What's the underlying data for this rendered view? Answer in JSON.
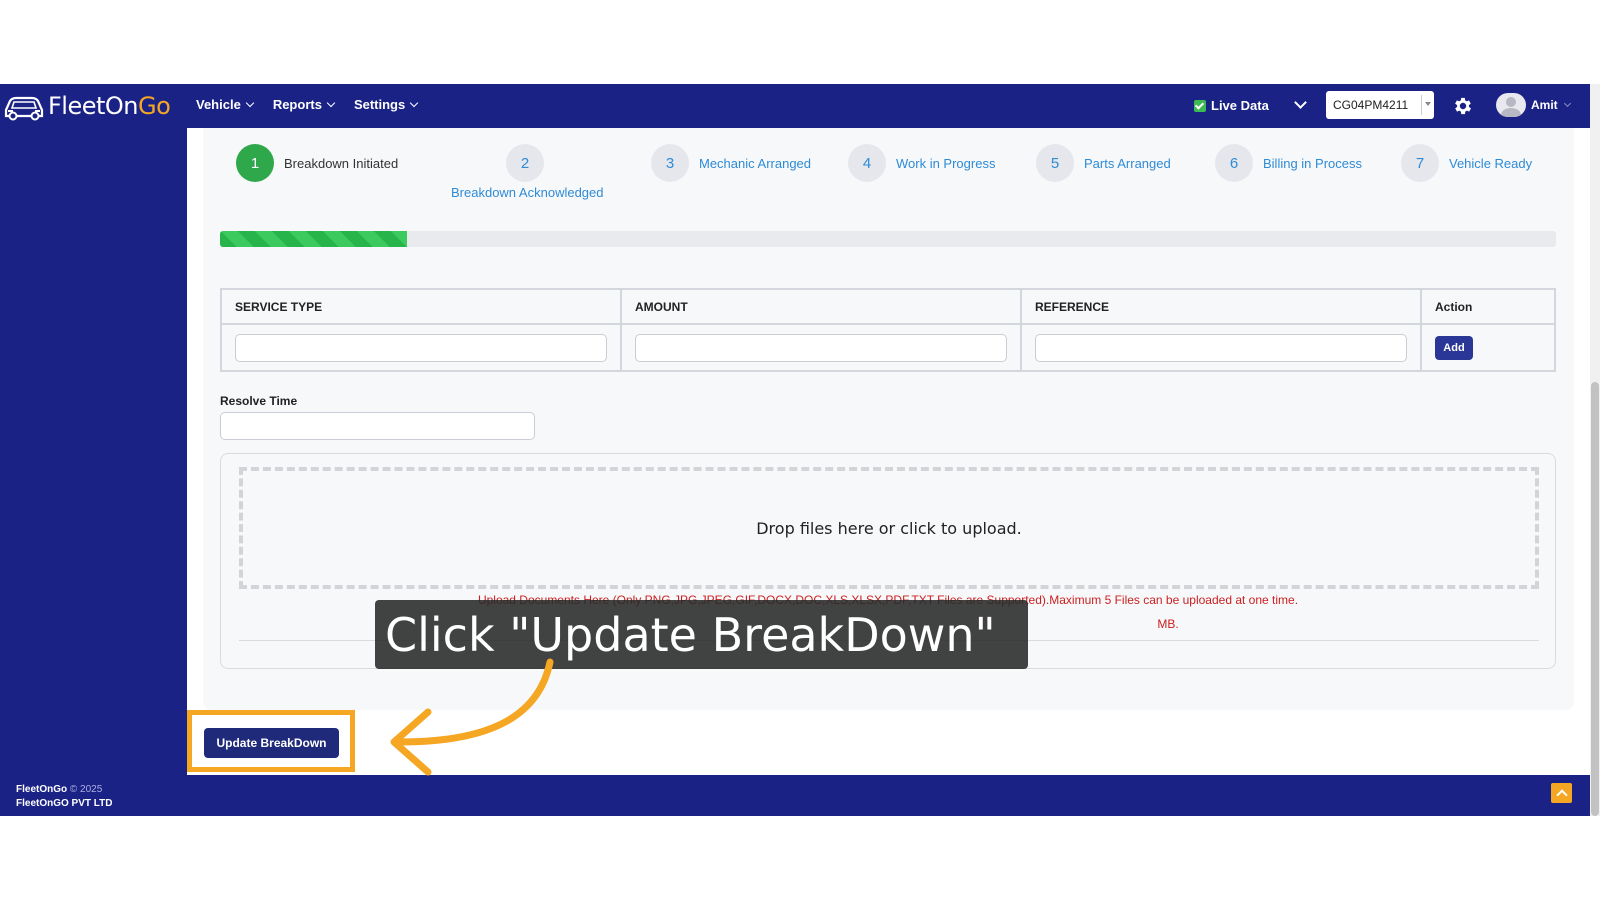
{
  "app": {
    "logo_brand": "FleetOn",
    "logo_accent": "Go"
  },
  "nav": {
    "menu": [
      {
        "label": "Vehicle"
      },
      {
        "label": "Reports"
      },
      {
        "label": "Settings"
      }
    ],
    "live_data_label": "Live Data",
    "vehicle_number": "CG04PM4211",
    "user_name": "Amit"
  },
  "steps": [
    {
      "num": "1",
      "label": "Breakdown Initiated",
      "state": "active"
    },
    {
      "num": "2",
      "label": "Breakdown Acknowledged",
      "state": "pending"
    },
    {
      "num": "3",
      "label": "Mechanic Arranged",
      "state": "pending"
    },
    {
      "num": "4",
      "label": "Work in Progress",
      "state": "pending"
    },
    {
      "num": "5",
      "label": "Parts Arranged",
      "state": "pending"
    },
    {
      "num": "6",
      "label": "Billing in Process",
      "state": "pending"
    },
    {
      "num": "7",
      "label": "Vehicle Ready",
      "state": "pending"
    }
  ],
  "progress": {
    "fraction": 0.14,
    "color": "#27b44a"
  },
  "service_table": {
    "headers": [
      "SERVICE TYPE",
      "AMOUNT",
      "REFERENCE",
      "Action"
    ],
    "add_label": "Add"
  },
  "resolve_time": {
    "label": "Resolve Time"
  },
  "upload": {
    "dropzone_text": "Drop files here or click to upload.",
    "note": "Upload Documents Here (Only PNG,JPG,JPEG,GIF,DOCX,DOC,XLS,XLSX,PDF,TXT Files are Supported).Maximum 5 Files can be uploaded at one time.",
    "note_size": "MB."
  },
  "update_button_label": "Update BreakDown",
  "footer": {
    "brand": "FleetOnGo",
    "year": "© 2025",
    "company": "FleetOnGO PVT LTD"
  },
  "tutorial": {
    "callout_text": "Click \"Update BreakDown\"",
    "accent_color": "#f5a623"
  }
}
